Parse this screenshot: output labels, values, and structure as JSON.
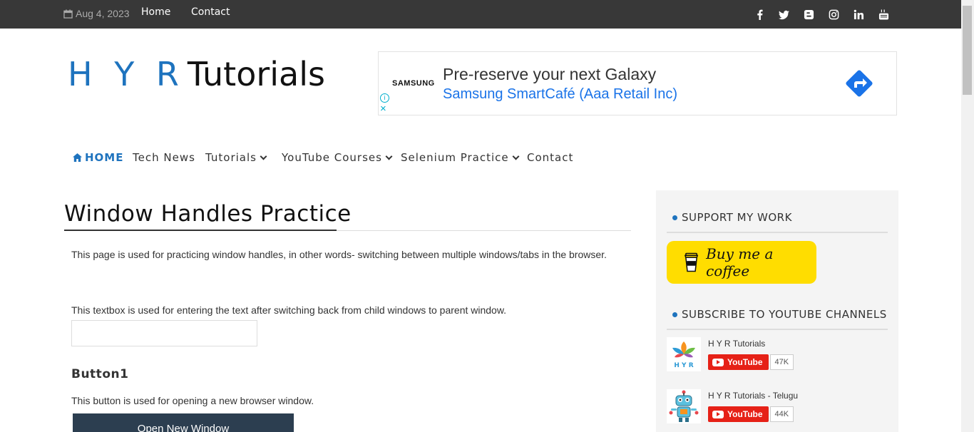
{
  "topbar": {
    "date": "Aug 4, 2023",
    "links": [
      "Home",
      "Contact"
    ],
    "social_icons": [
      "facebook-icon",
      "twitter-icon",
      "blogger-icon",
      "instagram-icon",
      "linkedin-icon",
      "youtube-icon"
    ]
  },
  "logo": {
    "part1": "H Y R",
    "part2": "Tutorials"
  },
  "ad": {
    "brand": "SAMSUNG",
    "headline": "Pre-reserve your next Galaxy",
    "subline": "Samsung SmartCafé (Aaa Retail Inc)",
    "info": "i",
    "close": "×"
  },
  "nav": {
    "items": [
      {
        "label": "HOME"
      },
      {
        "label": "Tech News"
      },
      {
        "label": "Tutorials"
      },
      {
        "label": "YouTube Courses"
      },
      {
        "label": "Selenium Practice"
      },
      {
        "label": "Contact"
      }
    ]
  },
  "main": {
    "title": "Window Handles Practice",
    "intro": "This page is used for practicing window handles, in other words- switching between multiple windows/tabs in the browser.",
    "textbox_desc": "This textbox is used for entering the text after switching back from child windows to parent window.",
    "textbox_value": "",
    "button1_heading": "Button1",
    "button1_desc": "This button is used for opening a new browser window.",
    "button1_label": "Open New Window"
  },
  "sidebar": {
    "support_heading": "SUPPORT MY WORK",
    "coffee_label": "Buy me a coffee",
    "subscribe_heading": "SUBSCRIBE TO YOUTUBE CHANNELS",
    "channels": [
      {
        "name": "H Y R Tutorials",
        "button": "YouTube",
        "count": "47K"
      },
      {
        "name": "H Y R Tutorials - Telugu",
        "button": "YouTube",
        "count": "44K"
      }
    ]
  },
  "colors": {
    "accent": "#1e73be",
    "topbar": "#383838",
    "button": "#2c3e50",
    "coffee": "#ffdd00",
    "youtube": "#e62117"
  }
}
